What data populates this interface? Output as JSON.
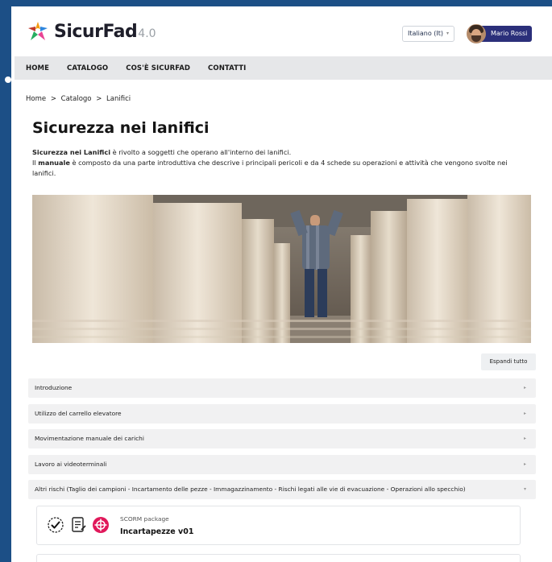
{
  "header": {
    "brand": "SicurFad",
    "version": "4.0",
    "language": "Italiano (It)",
    "user_name": "Mario Rossi"
  },
  "nav": {
    "items": [
      "HOME",
      "CATALOGO",
      "COS'È SICURFAD",
      "CONTATTI"
    ]
  },
  "breadcrumb": [
    "Home",
    ">",
    "Catalogo",
    ">",
    "Lanifici"
  ],
  "page": {
    "title": "Sicurezza nei lanifici",
    "intro_line1_bold": "Sicurezza nei Lanifici",
    "intro_line1_rest": " è rivolto a soggetti che operano all'interno dei lanifici.",
    "intro_line2_prefix": "Il ",
    "intro_line2_bold": "manuale",
    "intro_line2_rest": " è composto da una parte introduttiva che descrive i principali pericoli e da 4 schede su operazioni e attività che vengono svolte nei lanifici."
  },
  "expand_all": "Espandi tutto",
  "sections": [
    {
      "label": "Introduzione",
      "expanded": false
    },
    {
      "label": "Utilizzo del carrello elevatore",
      "expanded": false
    },
    {
      "label": "Movimentazione manuale dei carichi",
      "expanded": false
    },
    {
      "label": "Lavoro ai videoterminali",
      "expanded": false
    },
    {
      "label": "Altri rischi (Taglio dei campioni - Incartamento delle pezze - Immagazzinamento - Rischi legati alle vie di evacuazione - Operazioni allo specchio)",
      "expanded": true
    }
  ],
  "activity": {
    "type": "SCORM package",
    "name": "Incartapezze v01"
  },
  "icons": {
    "arrow_collapsed": "▸",
    "arrow_expanded": "▾"
  },
  "colors": {
    "outer_bg": "#1c4f86",
    "nav_bg": "#e6e7e9",
    "user_badge": "#2b2f7a",
    "scorm_icon": "#e0185a"
  }
}
